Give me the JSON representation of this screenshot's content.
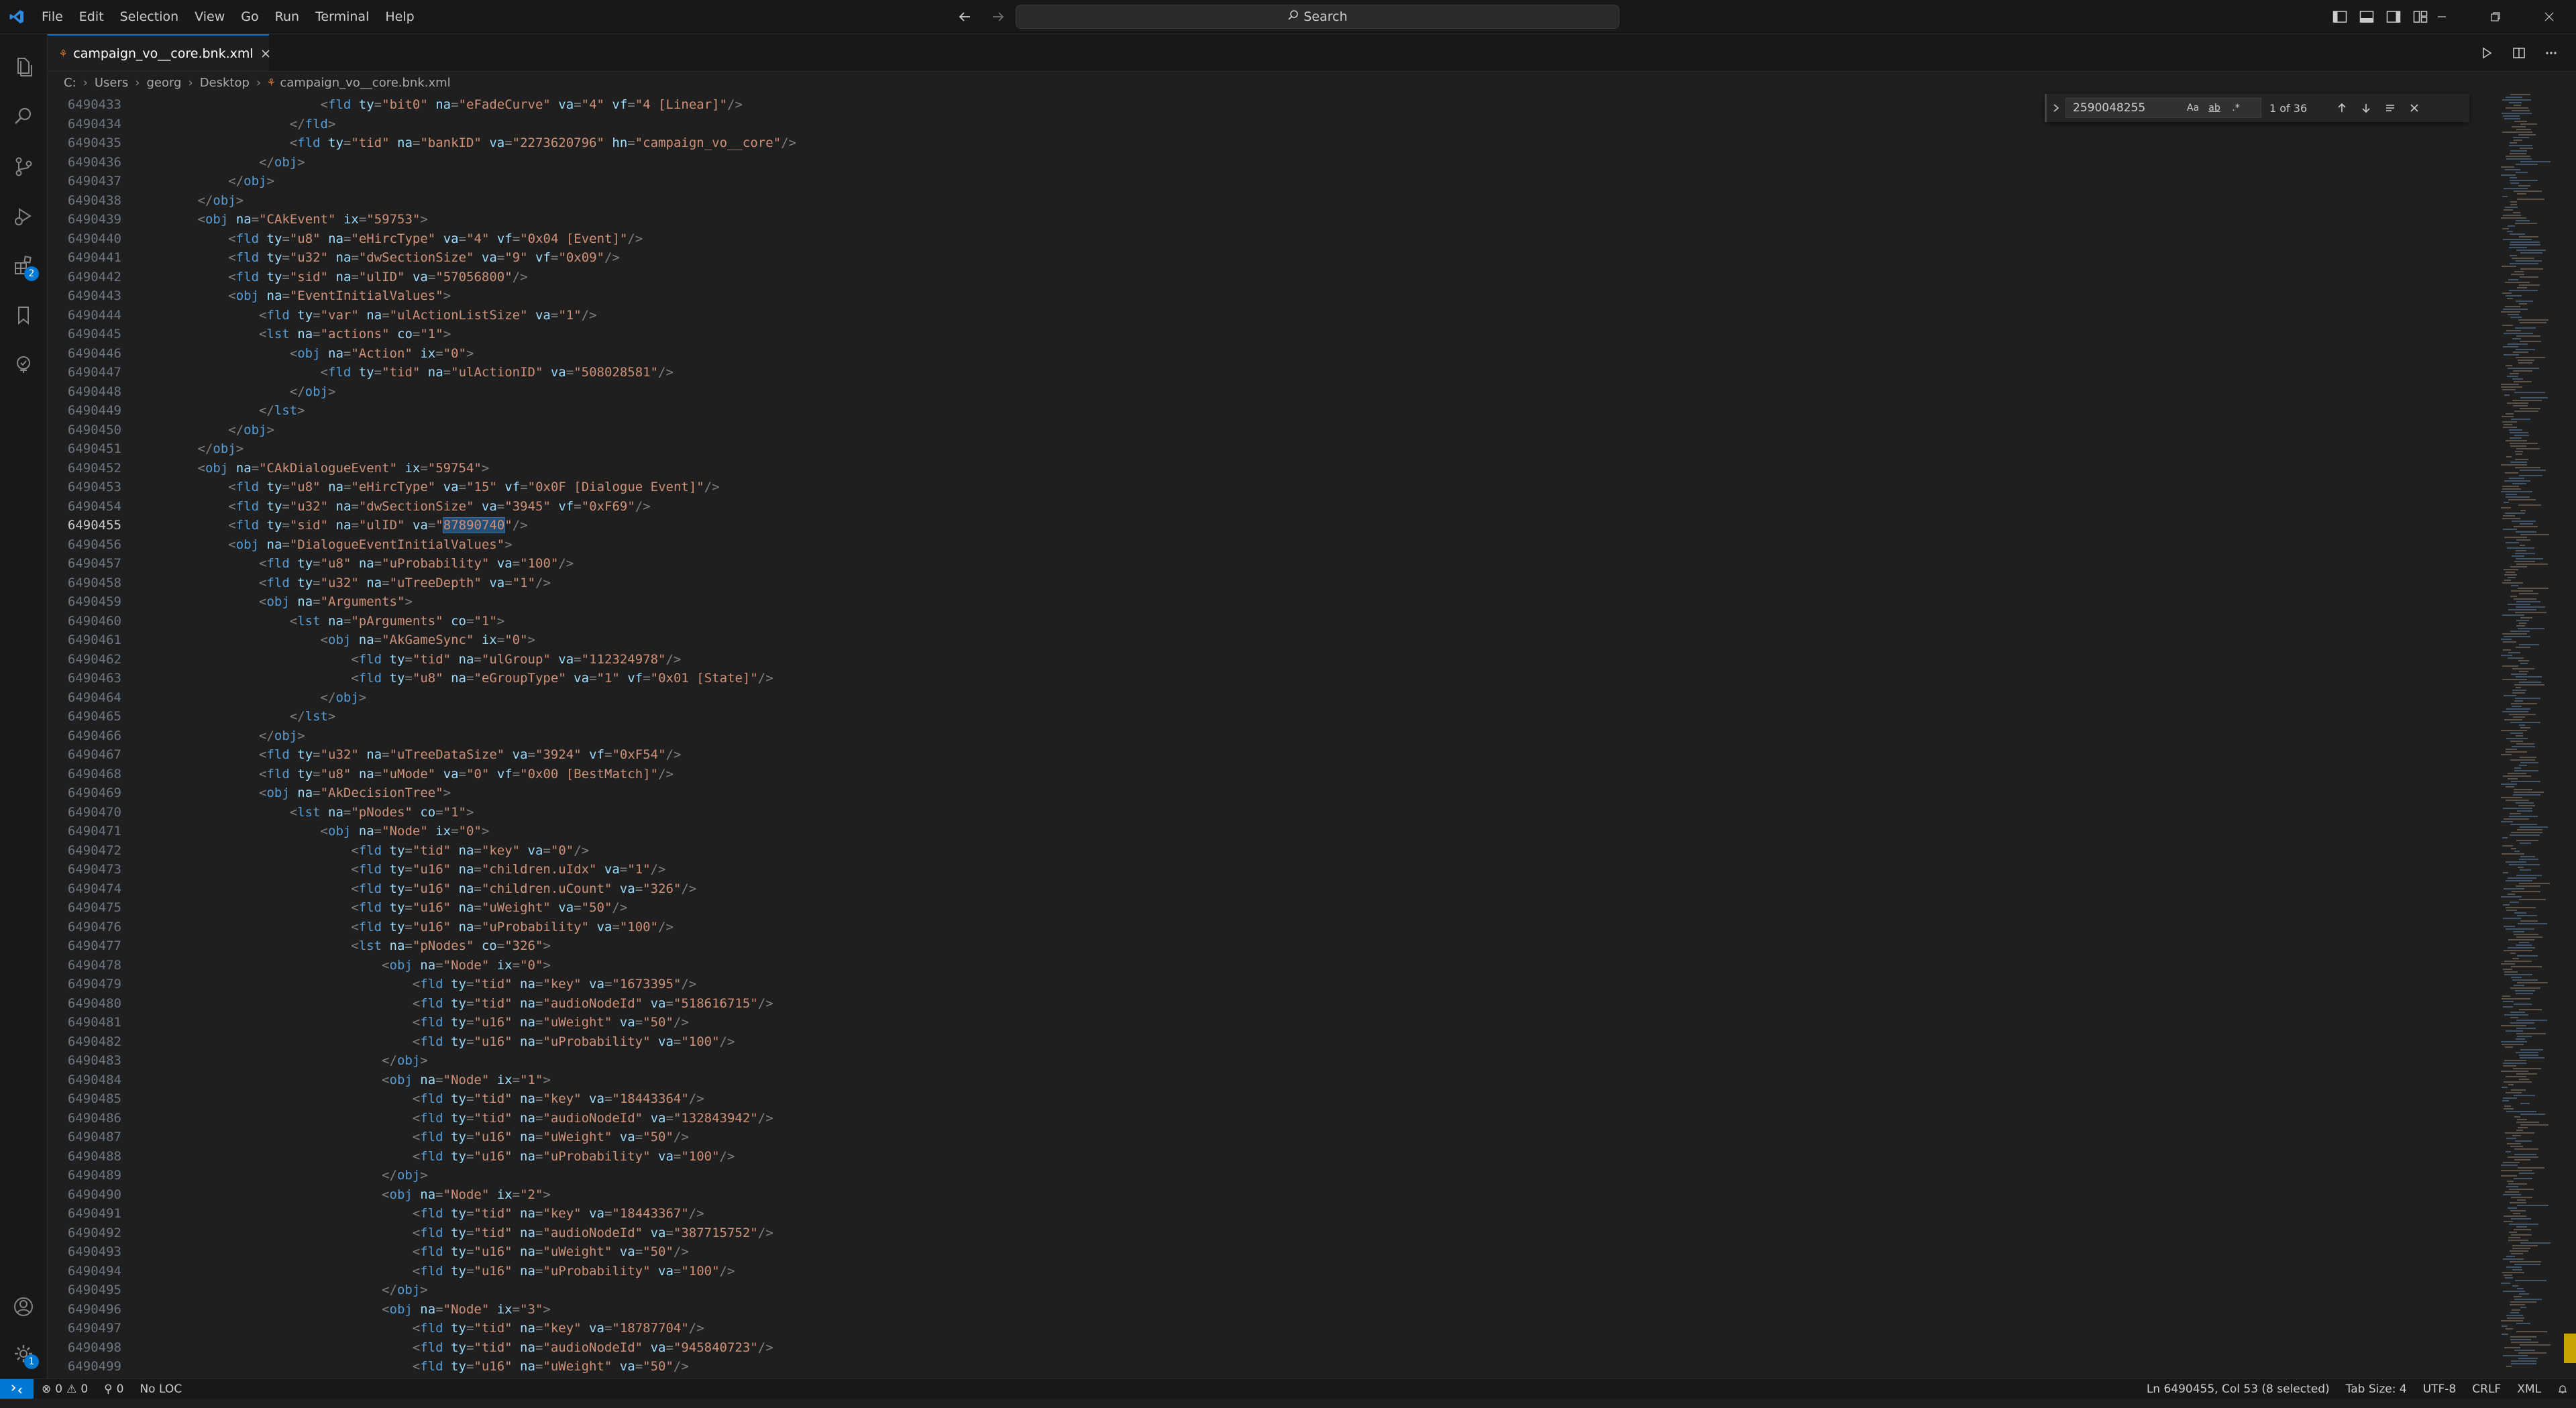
{
  "titlebar": {
    "menu": [
      "File",
      "Edit",
      "Selection",
      "View",
      "Go",
      "Run",
      "Terminal",
      "Help"
    ],
    "search_label": "Search"
  },
  "activity_bar": {
    "items": [
      "explorer-icon",
      "search-icon",
      "source-control-icon",
      "run-debug-icon",
      "extensions-icon",
      "bookmarks-icon",
      "remote-explorer-icon"
    ],
    "extensions_badge": "2",
    "settings_badge": "1"
  },
  "tab": {
    "label": "campaign_vo__core.bnk.xml",
    "icon_glyph": "⚘"
  },
  "breadcrumb": {
    "parts": [
      "C:",
      "Users",
      "georg",
      "Desktop"
    ],
    "file": "campaign_vo__core.bnk.xml"
  },
  "find_widget": {
    "query": "2590048255",
    "opt_case": "Aa",
    "opt_word": "ab",
    "opt_regex": ".*",
    "match_count": "1 of 36"
  },
  "editor": {
    "current_line": "6490455",
    "lines": [
      {
        "n": "6490433",
        "t": "                        <fld ty=\"bit0\" na=\"eFadeCurve\" va=\"4\" vf=\"4 [Linear]\"/>"
      },
      {
        "n": "6490434",
        "t": "                    </fld>"
      },
      {
        "n": "6490435",
        "t": "                    <fld ty=\"tid\" na=\"bankID\" va=\"2273620796\" hn=\"campaign_vo__core\"/>"
      },
      {
        "n": "6490436",
        "t": "                </obj>"
      },
      {
        "n": "6490437",
        "t": "            </obj>"
      },
      {
        "n": "6490438",
        "t": "        </obj>"
      },
      {
        "n": "6490439",
        "t": "        <obj na=\"CAkEvent\" ix=\"59753\">"
      },
      {
        "n": "6490440",
        "t": "            <fld ty=\"u8\" na=\"eHircType\" va=\"4\" vf=\"0x04 [Event]\"/>"
      },
      {
        "n": "6490441",
        "t": "            <fld ty=\"u32\" na=\"dwSectionSize\" va=\"9\" vf=\"0x09\"/>"
      },
      {
        "n": "6490442",
        "t": "            <fld ty=\"sid\" na=\"ulID\" va=\"57056800\"/>"
      },
      {
        "n": "6490443",
        "t": "            <obj na=\"EventInitialValues\">"
      },
      {
        "n": "6490444",
        "t": "                <fld ty=\"var\" na=\"ulActionListSize\" va=\"1\"/>"
      },
      {
        "n": "6490445",
        "t": "                <lst na=\"actions\" co=\"1\">"
      },
      {
        "n": "6490446",
        "t": "                    <obj na=\"Action\" ix=\"0\">"
      },
      {
        "n": "6490447",
        "t": "                        <fld ty=\"tid\" na=\"ulActionID\" va=\"508028581\"/>"
      },
      {
        "n": "6490448",
        "t": "                    </obj>"
      },
      {
        "n": "6490449",
        "t": "                </lst>"
      },
      {
        "n": "6490450",
        "t": "            </obj>"
      },
      {
        "n": "6490451",
        "t": "        </obj>"
      },
      {
        "n": "6490452",
        "t": "        <obj na=\"CAkDialogueEvent\" ix=\"59754\">"
      },
      {
        "n": "6490453",
        "t": "            <fld ty=\"u8\" na=\"eHircType\" va=\"15\" vf=\"0x0F [Dialogue Event]\"/>"
      },
      {
        "n": "6490454",
        "t": "            <fld ty=\"u32\" na=\"dwSectionSize\" va=\"3945\" vf=\"0xF69\"/>"
      },
      {
        "n": "6490455",
        "t": "            <fld ty=\"sid\" na=\"ulID\" va=\"87890740\"/>",
        "hl": "87890740"
      },
      {
        "n": "6490456",
        "t": "            <obj na=\"DialogueEventInitialValues\">"
      },
      {
        "n": "6490457",
        "t": "                <fld ty=\"u8\" na=\"uProbability\" va=\"100\"/>"
      },
      {
        "n": "6490458",
        "t": "                <fld ty=\"u32\" na=\"uTreeDepth\" va=\"1\"/>"
      },
      {
        "n": "6490459",
        "t": "                <obj na=\"Arguments\">"
      },
      {
        "n": "6490460",
        "t": "                    <lst na=\"pArguments\" co=\"1\">"
      },
      {
        "n": "6490461",
        "t": "                        <obj na=\"AkGameSync\" ix=\"0\">"
      },
      {
        "n": "6490462",
        "t": "                            <fld ty=\"tid\" na=\"ulGroup\" va=\"112324978\"/>"
      },
      {
        "n": "6490463",
        "t": "                            <fld ty=\"u8\" na=\"eGroupType\" va=\"1\" vf=\"0x01 [State]\"/>"
      },
      {
        "n": "6490464",
        "t": "                        </obj>"
      },
      {
        "n": "6490465",
        "t": "                    </lst>"
      },
      {
        "n": "6490466",
        "t": "                </obj>"
      },
      {
        "n": "6490467",
        "t": "                <fld ty=\"u32\" na=\"uTreeDataSize\" va=\"3924\" vf=\"0xF54\"/>"
      },
      {
        "n": "6490468",
        "t": "                <fld ty=\"u8\" na=\"uMode\" va=\"0\" vf=\"0x00 [BestMatch]\"/>"
      },
      {
        "n": "6490469",
        "t": "                <obj na=\"AkDecisionTree\">"
      },
      {
        "n": "6490470",
        "t": "                    <lst na=\"pNodes\" co=\"1\">"
      },
      {
        "n": "6490471",
        "t": "                        <obj na=\"Node\" ix=\"0\">"
      },
      {
        "n": "6490472",
        "t": "                            <fld ty=\"tid\" na=\"key\" va=\"0\"/>"
      },
      {
        "n": "6490473",
        "t": "                            <fld ty=\"u16\" na=\"children.uIdx\" va=\"1\"/>"
      },
      {
        "n": "6490474",
        "t": "                            <fld ty=\"u16\" na=\"children.uCount\" va=\"326\"/>"
      },
      {
        "n": "6490475",
        "t": "                            <fld ty=\"u16\" na=\"uWeight\" va=\"50\"/>"
      },
      {
        "n": "6490476",
        "t": "                            <fld ty=\"u16\" na=\"uProbability\" va=\"100\"/>"
      },
      {
        "n": "6490477",
        "t": "                            <lst na=\"pNodes\" co=\"326\">"
      },
      {
        "n": "6490478",
        "t": "                                <obj na=\"Node\" ix=\"0\">"
      },
      {
        "n": "6490479",
        "t": "                                    <fld ty=\"tid\" na=\"key\" va=\"1673395\"/>"
      },
      {
        "n": "6490480",
        "t": "                                    <fld ty=\"tid\" na=\"audioNodeId\" va=\"518616715\"/>"
      },
      {
        "n": "6490481",
        "t": "                                    <fld ty=\"u16\" na=\"uWeight\" va=\"50\"/>"
      },
      {
        "n": "6490482",
        "t": "                                    <fld ty=\"u16\" na=\"uProbability\" va=\"100\"/>"
      },
      {
        "n": "6490483",
        "t": "                                </obj>"
      },
      {
        "n": "6490484",
        "t": "                                <obj na=\"Node\" ix=\"1\">"
      },
      {
        "n": "6490485",
        "t": "                                    <fld ty=\"tid\" na=\"key\" va=\"18443364\"/>"
      },
      {
        "n": "6490486",
        "t": "                                    <fld ty=\"tid\" na=\"audioNodeId\" va=\"132843942\"/>"
      },
      {
        "n": "6490487",
        "t": "                                    <fld ty=\"u16\" na=\"uWeight\" va=\"50\"/>"
      },
      {
        "n": "6490488",
        "t": "                                    <fld ty=\"u16\" na=\"uProbability\" va=\"100\"/>"
      },
      {
        "n": "6490489",
        "t": "                                </obj>"
      },
      {
        "n": "6490490",
        "t": "                                <obj na=\"Node\" ix=\"2\">"
      },
      {
        "n": "6490491",
        "t": "                                    <fld ty=\"tid\" na=\"key\" va=\"18443367\"/>"
      },
      {
        "n": "6490492",
        "t": "                                    <fld ty=\"tid\" na=\"audioNodeId\" va=\"387715752\"/>"
      },
      {
        "n": "6490493",
        "t": "                                    <fld ty=\"u16\" na=\"uWeight\" va=\"50\"/>"
      },
      {
        "n": "6490494",
        "t": "                                    <fld ty=\"u16\" na=\"uProbability\" va=\"100\"/>"
      },
      {
        "n": "6490495",
        "t": "                                </obj>"
      },
      {
        "n": "6490496",
        "t": "                                <obj na=\"Node\" ix=\"3\">"
      },
      {
        "n": "6490497",
        "t": "                                    <fld ty=\"tid\" na=\"key\" va=\"18787704\"/>"
      },
      {
        "n": "6490498",
        "t": "                                    <fld ty=\"tid\" na=\"audioNodeId\" va=\"945840723\"/>"
      },
      {
        "n": "6490499",
        "t": "                                    <fld ty=\"u16\" na=\"uWeight\" va=\"50\"/>"
      }
    ]
  },
  "statusbar": {
    "errors": "0",
    "warnings": "0",
    "ports": "0",
    "loc": "No LOC",
    "position": "Ln 6490455, Col 53 (8 selected)",
    "tab_size": "Tab Size: 4",
    "encoding": "UTF-8",
    "eol": "CRLF",
    "language": "XML"
  },
  "colors": {
    "accent": "#0078d4",
    "tag": "#569cd6",
    "attribute": "#9cdcfe",
    "string": "#ce9178",
    "selection": "#264f78"
  }
}
